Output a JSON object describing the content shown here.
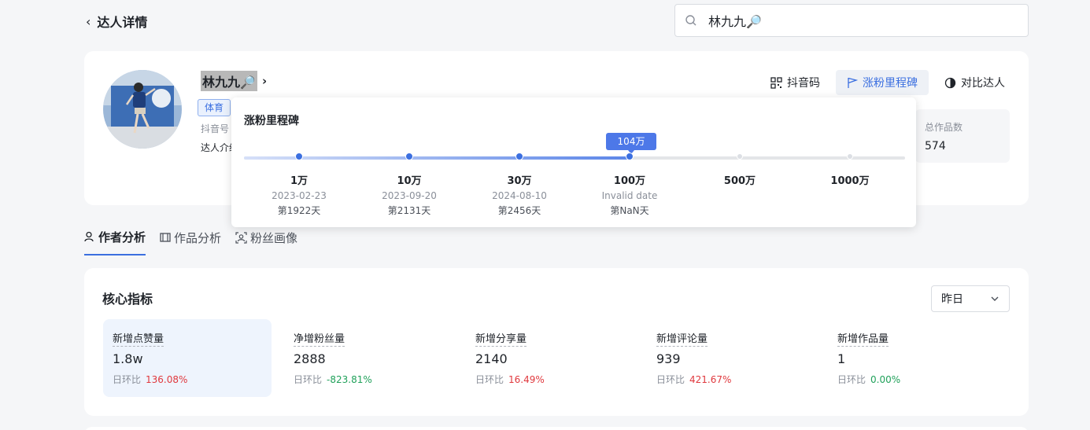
{
  "header": {
    "back_label": "达人详情",
    "search_value": "林九九🔎"
  },
  "profile": {
    "name": "林九九🔎",
    "tag": "体育",
    "douyin_id_label": "抖音号",
    "intro_label": "达人介绍",
    "actions": [
      {
        "label": "抖音码",
        "icon": "qrcode-icon"
      },
      {
        "label": "涨粉里程碑",
        "icon": "flag-icon"
      },
      {
        "label": "对比达人",
        "icon": "compare-icon"
      }
    ],
    "stat": {
      "label": "总作品数",
      "value": "574"
    }
  },
  "milestone": {
    "title": "涨粉里程碑",
    "current_label": "104万",
    "progress_fraction": 0.585,
    "items": [
      {
        "level": "1万",
        "date": "2023-02-23",
        "day": "第1922天",
        "reached": true
      },
      {
        "level": "10万",
        "date": "2023-09-20",
        "day": "第2131天",
        "reached": true
      },
      {
        "level": "30万",
        "date": "2024-08-10",
        "day": "第2456天",
        "reached": true
      },
      {
        "level": "100万",
        "date": "Invalid date",
        "day": "第NaN天",
        "reached": true
      },
      {
        "level": "500万",
        "date": "",
        "day": "",
        "reached": false
      },
      {
        "level": "1000万",
        "date": "",
        "day": "",
        "reached": false
      }
    ]
  },
  "tabs": [
    {
      "label": "作者分析",
      "icon": "user-icon",
      "active": true
    },
    {
      "label": "作品分析",
      "icon": "film-icon",
      "active": false
    },
    {
      "label": "粉丝画像",
      "icon": "portrait-icon",
      "active": false
    }
  ],
  "core": {
    "title": "核心指标",
    "period": "昨日",
    "compare_label": "日环比",
    "metrics": [
      {
        "label": "新增点赞量",
        "value": "1.8w",
        "change": "136.08%",
        "trend": "up",
        "active": true
      },
      {
        "label": "净增粉丝量",
        "value": "2888",
        "change": "-823.81%",
        "trend": "down",
        "active": false
      },
      {
        "label": "新增分享量",
        "value": "2140",
        "change": "16.49%",
        "trend": "up",
        "active": false
      },
      {
        "label": "新增评论量",
        "value": "939",
        "change": "421.67%",
        "trend": "up",
        "active": false
      },
      {
        "label": "新增作品量",
        "value": "1",
        "change": "0.00%",
        "trend": "down",
        "active": false
      }
    ]
  },
  "colors": {
    "accent": "#3b6fe0",
    "up": "#e0393e",
    "down": "#20a15a"
  }
}
